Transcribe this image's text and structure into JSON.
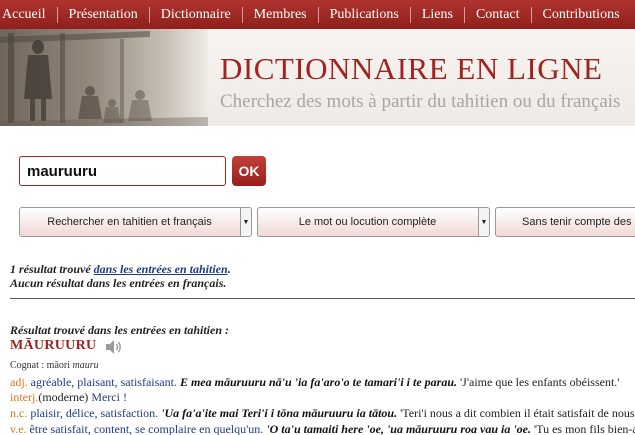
{
  "nav": {
    "items": [
      "Accueil",
      "Présentation",
      "Dictionnaire",
      "Membres",
      "Publications",
      "Liens",
      "Contact",
      "Contributions"
    ]
  },
  "header": {
    "title": "DICTIONNAIRE EN LIGNE",
    "subtitle": "Cherchez des mots à partir du tahitien ou du français"
  },
  "search": {
    "value": "mauruuru",
    "ok_label": "OK"
  },
  "options": {
    "language": "Rechercher en tahitien et français",
    "match": "Le mot ou locution complète",
    "accents": "Sans tenir compte des accents"
  },
  "results": {
    "line1_prefix": "1 résultat trouvé ",
    "line1_link": "dans les entrées en tahitien",
    "line1_suffix": ".",
    "line2": "Aucun résultat dans les entrées en français."
  },
  "entry": {
    "found_label": "Résultat trouvé dans les entrées en tahitien :",
    "headword": "MĀURUURU",
    "cognate_label": "Cognat : māori ",
    "cognate_word": "mauru",
    "senses": [
      {
        "pos": "adj.",
        "gloss": "agréable, plaisant, satisfaisant.",
        "example": "E mea māuruuru nā'u 'ia fa'aro'o te tamari'i i te parau.",
        "translation": "'J'aime que les enfants obéissent.'"
      },
      {
        "pos": "interj.",
        "note": "(moderne)",
        "gloss": "Merci !",
        "example": "",
        "translation": ""
      },
      {
        "pos": "n.c.",
        "gloss": "plaisir, délice, satisfaction.",
        "example": "'Ua fa'a'ite mai Teri'i i tōna māuruuru ia tātou.",
        "translation": "'Teri'i nous a dit combien il était satisfait de nous.'"
      },
      {
        "pos": "v.e.",
        "gloss": "être satisfait, content, se complaire en quelqu'un.",
        "example": "'O ta'u tamaiti here 'oe, 'ua māuruuru roa vau ia 'oe.",
        "translation": "'Tu es mon fils bien-aimé.'"
      }
    ]
  }
}
